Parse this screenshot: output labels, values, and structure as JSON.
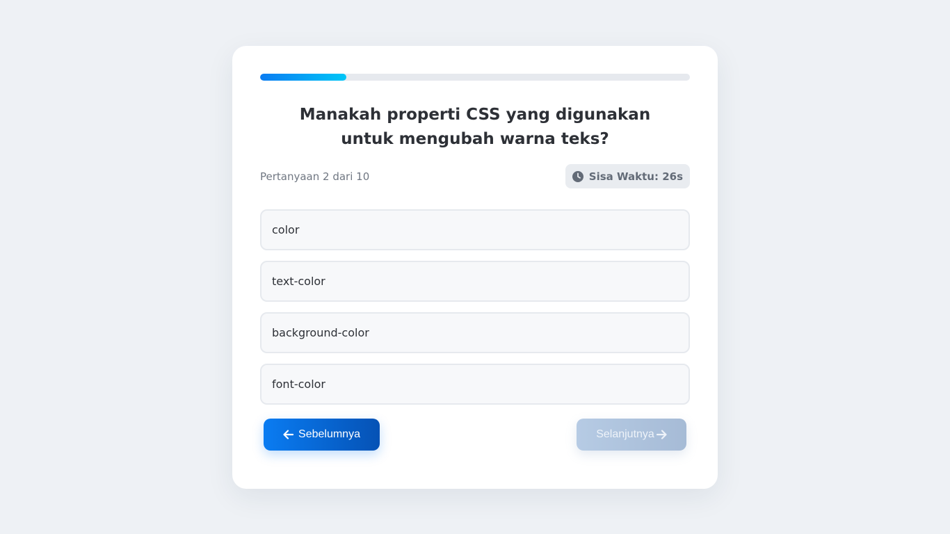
{
  "quiz": {
    "progress_fraction": 0.2,
    "question": "Manakah properti CSS yang digunakan untuk mengubah warna teks?",
    "counter": "Pertanyaan 2 dari 10",
    "timer": {
      "icon": "clock-icon",
      "label": "Sisa Waktu: 26s"
    },
    "options": [
      "color",
      "text-color",
      "background-color",
      "font-color"
    ],
    "prev_label": "Sebelumnya",
    "next_label": "Selanjutnya",
    "next_disabled": true
  },
  "colors": {
    "accent": "#0a7cf2",
    "accent_light": "#00c6f7",
    "background": "#eef1f5"
  }
}
